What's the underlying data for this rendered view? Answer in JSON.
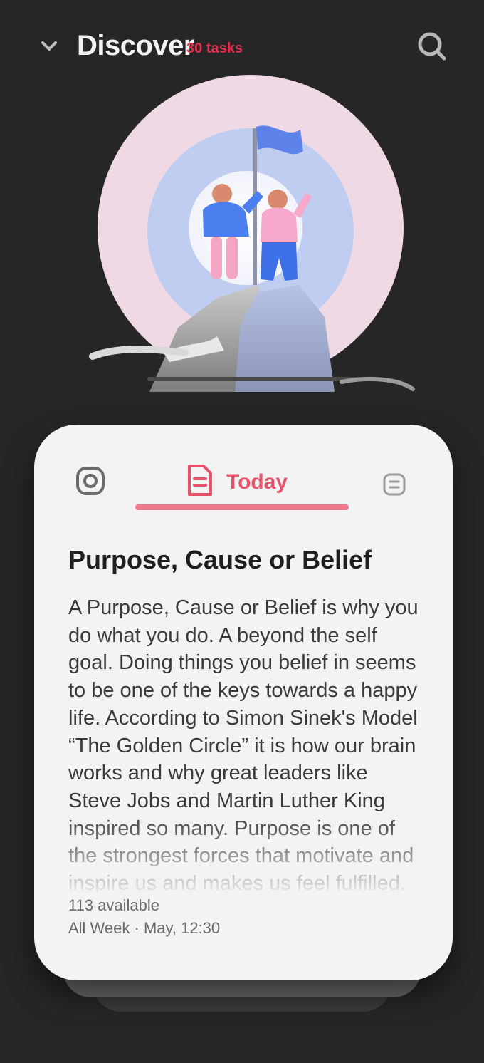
{
  "header": {
    "title": "Discover",
    "badge": "30 tasks",
    "chevron_icon": "chevron-down-icon",
    "search_icon": "search-icon"
  },
  "illustration": {
    "description_icon": "celebration-illustration"
  },
  "card": {
    "tab": {
      "label": "Today",
      "icon": "document-icon"
    },
    "left_icon": "settings-icon",
    "right_icon": "more-icon",
    "title": "Purpose, Cause or Belief",
    "body": "A Purpose, Cause or Belief is why you do what you do. A beyond the self goal. Doing things you belief in seems to be one of the keys towards a happy life. According to Simon Sinek's Model “The Golden Circle” it is how our brain works and why great leaders like Steve Jobs and Martin Luther King inspired so many. Purpose is one of the strongest forces that motivate and inspire us and makes us feel fulfilled.",
    "meta_line1": "113 available",
    "meta_line2": "All Week · May, 12:30"
  },
  "colors": {
    "background": "#262626",
    "card": "#f3f3f3",
    "accent": "#e8516a",
    "badge": "#e0304c"
  }
}
